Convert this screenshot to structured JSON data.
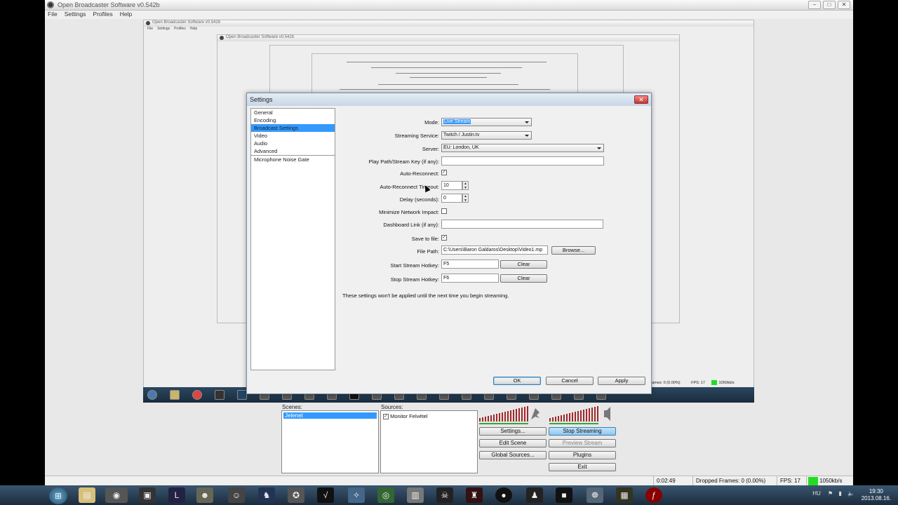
{
  "window": {
    "title": "Open Broadcaster Software v0.542b",
    "menu": [
      "File",
      "Settings",
      "Profiles",
      "Help"
    ]
  },
  "dialog": {
    "title": "Settings",
    "nav": [
      "General",
      "Encoding",
      "Broadcast Settings",
      "Video",
      "Audio",
      "Advanced",
      "Microphone Noise Gate"
    ],
    "fields": {
      "mode_label": "Mode:",
      "mode_value": "Live Stream",
      "service_label": "Streaming Service:",
      "service_value": "Twitch / Justin.tv",
      "server_label": "Server:",
      "server_value": "EU: London, UK",
      "playpath_label": "Play Path/Stream Key (if any):",
      "playpath_value": "",
      "autoreconnect_label": "Auto-Reconnect:",
      "timeout_label": "Auto-Reconnect Timeout:",
      "timeout_value": "10",
      "delay_label": "Delay (seconds):",
      "delay_value": "0",
      "minimize_label": "Minimize Network Impact:",
      "dashboard_label": "Dashboard Link (if any):",
      "dashboard_value": "",
      "savefile_label": "Save to file:",
      "filepath_label": "File Path:",
      "filepath_value": "C:\\Users\\Baron Galdaros\\Desktop\\Video1.mp",
      "browse_label": "Browse...",
      "start_hotkey_label": "Start Stream Hotkey:",
      "start_hotkey_value": "F5",
      "stop_hotkey_label": "Stop Stream Hotkey:",
      "stop_hotkey_value": "F6",
      "clear_label": "Clear"
    },
    "note": "These settings won't be applied until the next time you begin streaming.",
    "ok": "OK",
    "cancel": "Cancel",
    "apply": "Apply",
    "checks": {
      "autoreconnect": true,
      "minimize": false,
      "savefile": true
    }
  },
  "main": {
    "scenes_label": "Scenes:",
    "scenes": [
      "Jelenet"
    ],
    "sources_label": "Sources:",
    "sources": [
      "Monitor Felvétel"
    ],
    "buttons": {
      "settings": "Settings...",
      "stop_streaming": "Stop Streaming",
      "edit_scene": "Edit Scene",
      "preview_stream": "Preview Stream",
      "global_sources": "Global Sources...",
      "plugins": "Plugins",
      "exit": "Exit"
    }
  },
  "status": {
    "time": "0:02:49",
    "dropped": "Dropped Frames: 0 (0.00%)",
    "fps": "FPS: 17",
    "bitrate": "1050kb/s",
    "mini_dropped": "Frames: 0 (0.00%)",
    "mini_fps": "FPS: 17",
    "mini_bitrate": "1050kb/s"
  },
  "taskbar": {
    "lang": "HU",
    "clock_time": "19:30",
    "clock_date": "2013.08.16."
  },
  "colors": {
    "accent": "#3399ff",
    "meter_red": "#a0282a",
    "meter_green": "#33aa33",
    "status_green": "#22dd22"
  }
}
